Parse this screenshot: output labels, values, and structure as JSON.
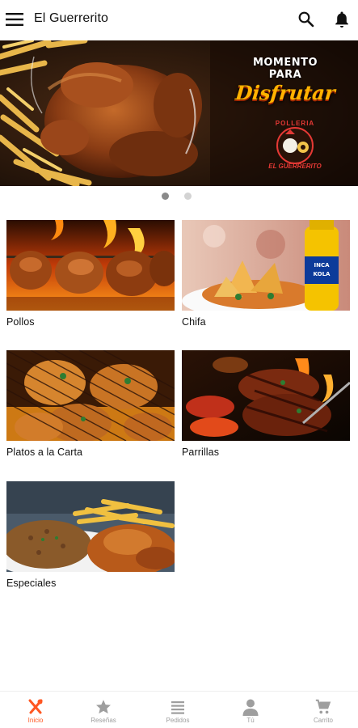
{
  "app": {
    "title": "El Guerrerito"
  },
  "banner": {
    "line1": "MOMENTO",
    "line2": "PARA",
    "headline": "Disfrutar",
    "logo_top": "POLLERIA",
    "logo_bottom": "EL GUERRERITO",
    "active_slide": 1,
    "slide_count": 2
  },
  "categories": [
    {
      "label": "Pollos",
      "image": "rotisserie-chickens-photo"
    },
    {
      "label": "Chifa",
      "image": "chifa-plate-inca-kola-photo"
    },
    {
      "label": "Platos a la Carta",
      "image": "grilled-chicken-photo"
    },
    {
      "label": "Parrillas",
      "image": "grilled-steak-photo"
    },
    {
      "label": "Especiales",
      "image": "rice-chicken-fries-photo"
    }
  ],
  "bottom_nav": [
    {
      "label": "Inicio",
      "icon": "utensils-icon",
      "active": true
    },
    {
      "label": "Reseñas",
      "icon": "star-icon",
      "active": false
    },
    {
      "label": "Pedidos",
      "icon": "list-icon",
      "active": false
    },
    {
      "label": "Tú",
      "icon": "person-icon",
      "active": false
    },
    {
      "label": "Carrito",
      "icon": "cart-icon",
      "active": false
    }
  ],
  "colors": {
    "accent": "#ff5722",
    "inactive": "#9e9e9e",
    "banner_headline": "#ffb300"
  }
}
